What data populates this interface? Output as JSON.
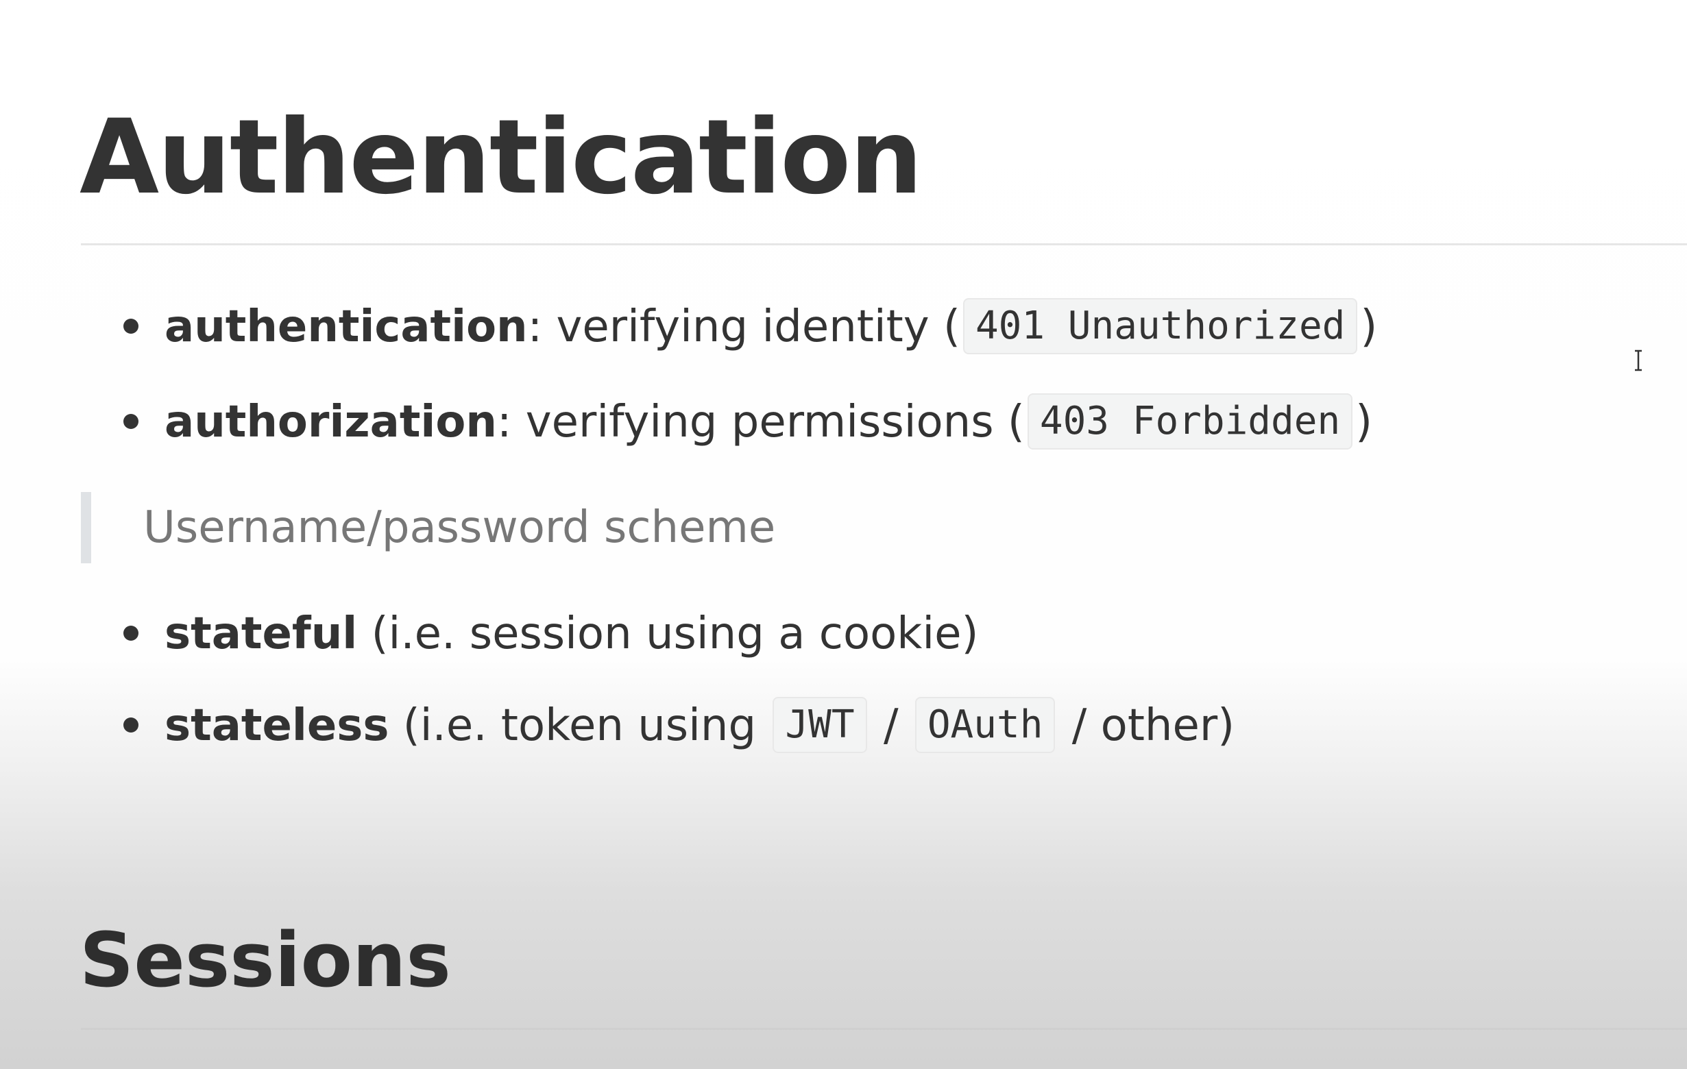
{
  "heading": "Authentication",
  "list_1": [
    {
      "term": "authentication",
      "sep": ":",
      "text": " verifying identity (",
      "code": "401 Unauthorized",
      "after": ")"
    },
    {
      "term": "authorization",
      "sep": ":",
      "text": " verifying permissions (",
      "code": "403 Forbidden",
      "after": ")"
    }
  ],
  "blockquote": "Username/password scheme",
  "list_2": [
    {
      "term": "stateful",
      "text": " (i.e. session using a cookie)"
    },
    {
      "term": "stateless",
      "text": " (i.e. token using ",
      "code_1": "JWT",
      "mid": " / ",
      "code_2": "OAuth",
      "after": " / other)"
    }
  ],
  "subheading": "Sessions",
  "icons": {
    "cursor": "text-cursor-icon"
  },
  "colors": {
    "text": "#333333",
    "quote_text": "#777777",
    "quote_border": "#dfe2e5",
    "code_bg": "#f3f4f4"
  }
}
